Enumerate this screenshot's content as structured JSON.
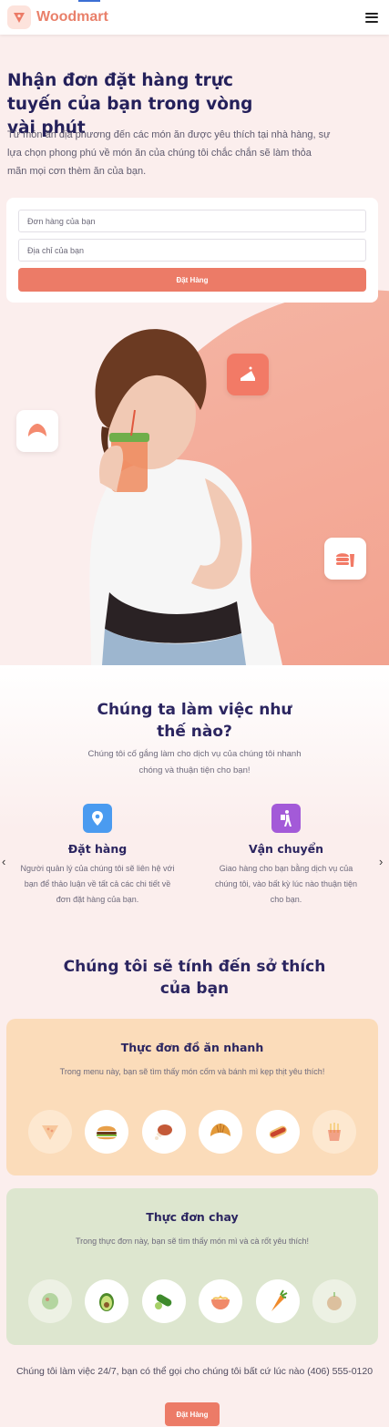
{
  "brand": {
    "name": "Woodmart",
    "accent": "#ec7b67"
  },
  "hero": {
    "title": "Nhận đơn đặt hàng trực tuyến của bạn trong vòng vài phút",
    "lead": "Từ món ăn địa phương đến các món ăn được yêu thích tại nhà hàng, sự lựa chọn phong phú về món ăn của chúng tôi chắc chắn sẽ làm thỏa mãn mọi cơn thèm ăn của bạn."
  },
  "form": {
    "order_placeholder": "Đơn hàng của bạn",
    "address_placeholder": "Địa chỉ của bạn",
    "submit_label": "Đặt Hàng"
  },
  "how": {
    "title": "Chúng ta làm việc như thế nào?",
    "subtitle": "Chúng tôi cố gắng làm cho dịch vụ của chúng tôi nhanh chóng và thuận tiện cho bạn!",
    "steps": [
      {
        "title": "Đặt hàng",
        "text": "Người quản lý của chúng tôi sẽ liên hệ với bạn để thảo luận về tất cả các chi tiết về đơn đặt hàng của bạn.",
        "icon": "location-pin-icon",
        "color": "#4a9bf0"
      },
      {
        "title": "Vận chuyển",
        "text": "Giao hàng cho bạn bằng dịch vụ của chúng tôi, vào bất kỳ lúc nào thuận tiện cho bạn.",
        "icon": "courier-icon",
        "color": "#a35ad8"
      }
    ]
  },
  "preferences": {
    "title": "Chúng tôi sẽ tính đến sở thích của bạn",
    "menus": [
      {
        "title": "Thực đơn đồ ăn nhanh",
        "desc": "Trong menu này, bạn sẽ tìm thấy món cốm và bánh mì kẹp thịt yêu thích!",
        "bg": "#fbdcba",
        "items": [
          "pizza-icon",
          "burger-icon",
          "chicken-leg-icon",
          "croissant-icon",
          "hotdog-icon",
          "fries-icon"
        ]
      },
      {
        "title": "Thực đơn chay",
        "desc": "Trong thực đơn này, bạn sẽ tìm thấy món mì và cà rốt yêu thích!",
        "bg": "#dde6cf",
        "items": [
          "salad-icon",
          "avocado-icon",
          "cucumber-icon",
          "noodle-bowl-icon",
          "carrot-icon",
          "onion-icon"
        ]
      }
    ]
  },
  "footer": {
    "text": "Chúng tôi làm việc 24/7, bạn có thể gọi cho chúng tôi bất cứ lúc nào (406) 555-0120",
    "button_label": "Đặt Hàng"
  }
}
